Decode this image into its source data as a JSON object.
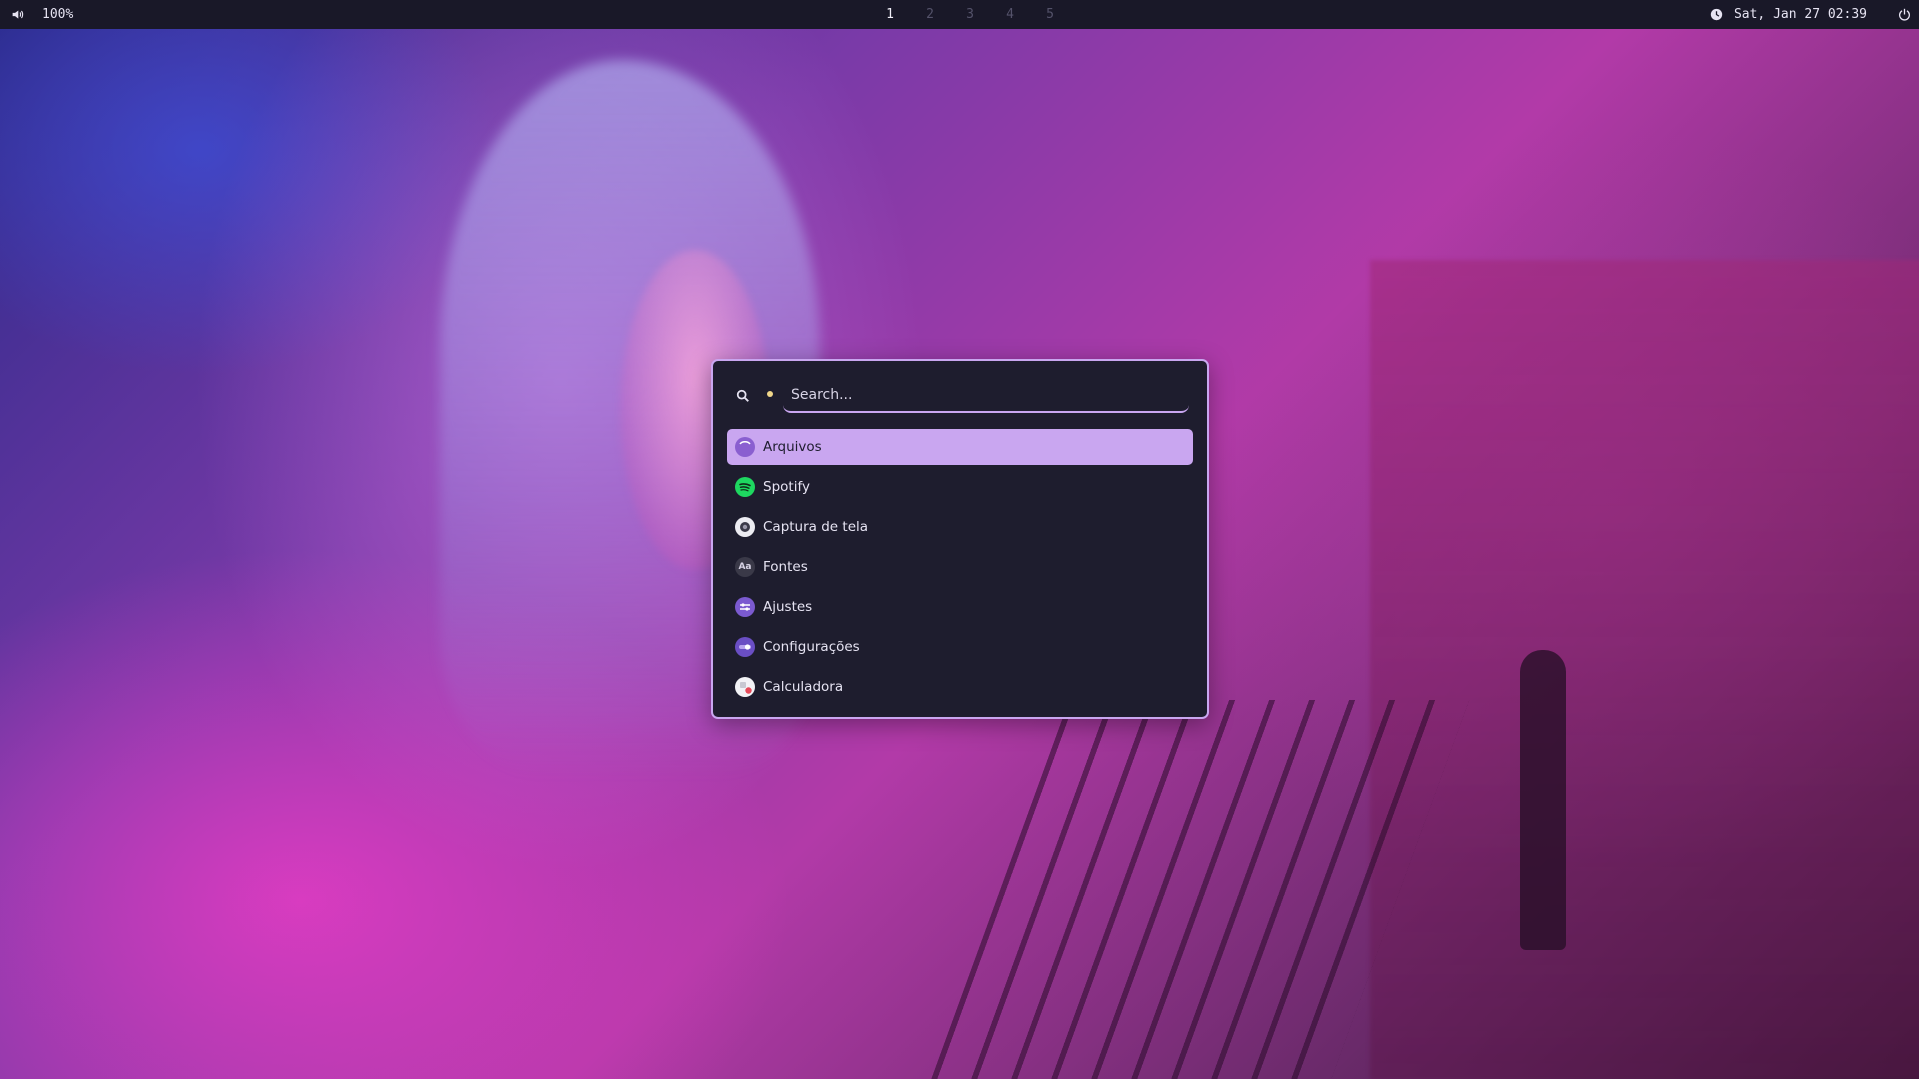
{
  "topbar": {
    "volume": "100%",
    "volume_icon": "speaker-icon",
    "workspaces": [
      {
        "label": "1",
        "active": true
      },
      {
        "label": "2",
        "active": false
      },
      {
        "label": "3",
        "active": false
      },
      {
        "label": "4",
        "active": false
      },
      {
        "label": "5",
        "active": false
      }
    ],
    "clock_icon": "clock-icon",
    "datetime": "Sat, Jan 27 02:39",
    "power_icon": "power-icon"
  },
  "launcher": {
    "search_icon": "search-icon",
    "search_placeholder": "Search...",
    "search_value": "",
    "results": [
      {
        "label": "Arquivos",
        "icon": "files-app-icon",
        "selected": true
      },
      {
        "label": "Spotify",
        "icon": "spotify-app-icon",
        "selected": false
      },
      {
        "label": "Captura de tela",
        "icon": "screenshot-app-icon",
        "selected": false
      },
      {
        "label": "Fontes",
        "icon": "fonts-app-icon",
        "icon_text": "Aa",
        "selected": false
      },
      {
        "label": "Ajustes",
        "icon": "tweaks-app-icon",
        "selected": false
      },
      {
        "label": "Configurações",
        "icon": "settings-app-icon",
        "selected": false
      },
      {
        "label": "Calculadora",
        "icon": "calculator-app-icon",
        "selected": false
      }
    ]
  },
  "colors": {
    "bar_background": "#191828",
    "launcher_background": "#1e1d2e",
    "accent": "#c9a6f0",
    "text": "#e6e3f2",
    "inactive_workspace": "#54526a"
  }
}
